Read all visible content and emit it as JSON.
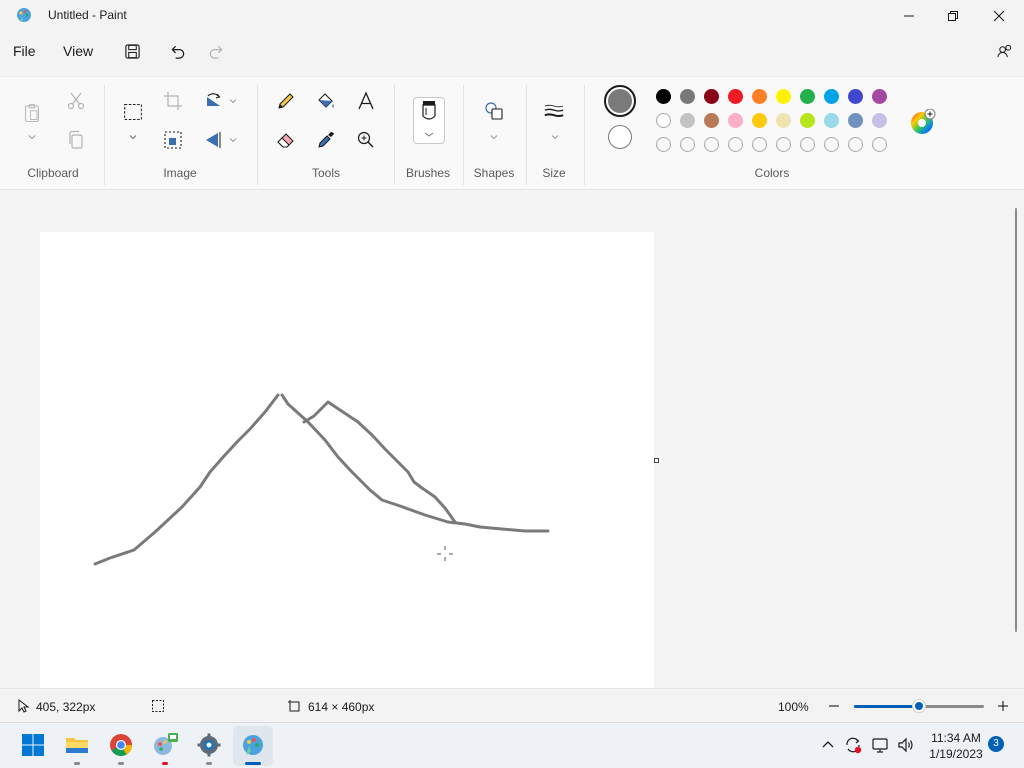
{
  "window": {
    "title": "Untitled - Paint"
  },
  "menu": {
    "file": "File",
    "view": "View"
  },
  "ribbon": {
    "groups": {
      "clipboard": "Clipboard",
      "image": "Image",
      "tools": "Tools",
      "brushes": "Brushes",
      "shapes": "Shapes",
      "size": "Size",
      "colors": "Colors"
    }
  },
  "colors": {
    "primary": "#7a7a7a",
    "secondary": "#ffffff",
    "palette_row1": [
      "#000000",
      "#787878",
      "#880015",
      "#ed1c24",
      "#ff7f27",
      "#fff200",
      "#22b14c",
      "#00a2e8",
      "#3f48cc",
      "#a349a4"
    ],
    "palette_row2": [
      "#ffffff",
      "#c3c3c3",
      "#b97a57",
      "#ffaec9",
      "#ffc90e",
      "#efe4b0",
      "#b5e61d",
      "#99d9ea",
      "#7092be",
      "#c8bfe7"
    ],
    "palette_row3_count_empty": 10
  },
  "status": {
    "cursor_position": "405, 322px",
    "canvas_size": "614 × 460px",
    "zoom": "100%",
    "zoom_level": 0.5
  },
  "taskbar": {
    "time": "11:34 AM",
    "date": "1/19/2023",
    "notification_count": "3"
  }
}
